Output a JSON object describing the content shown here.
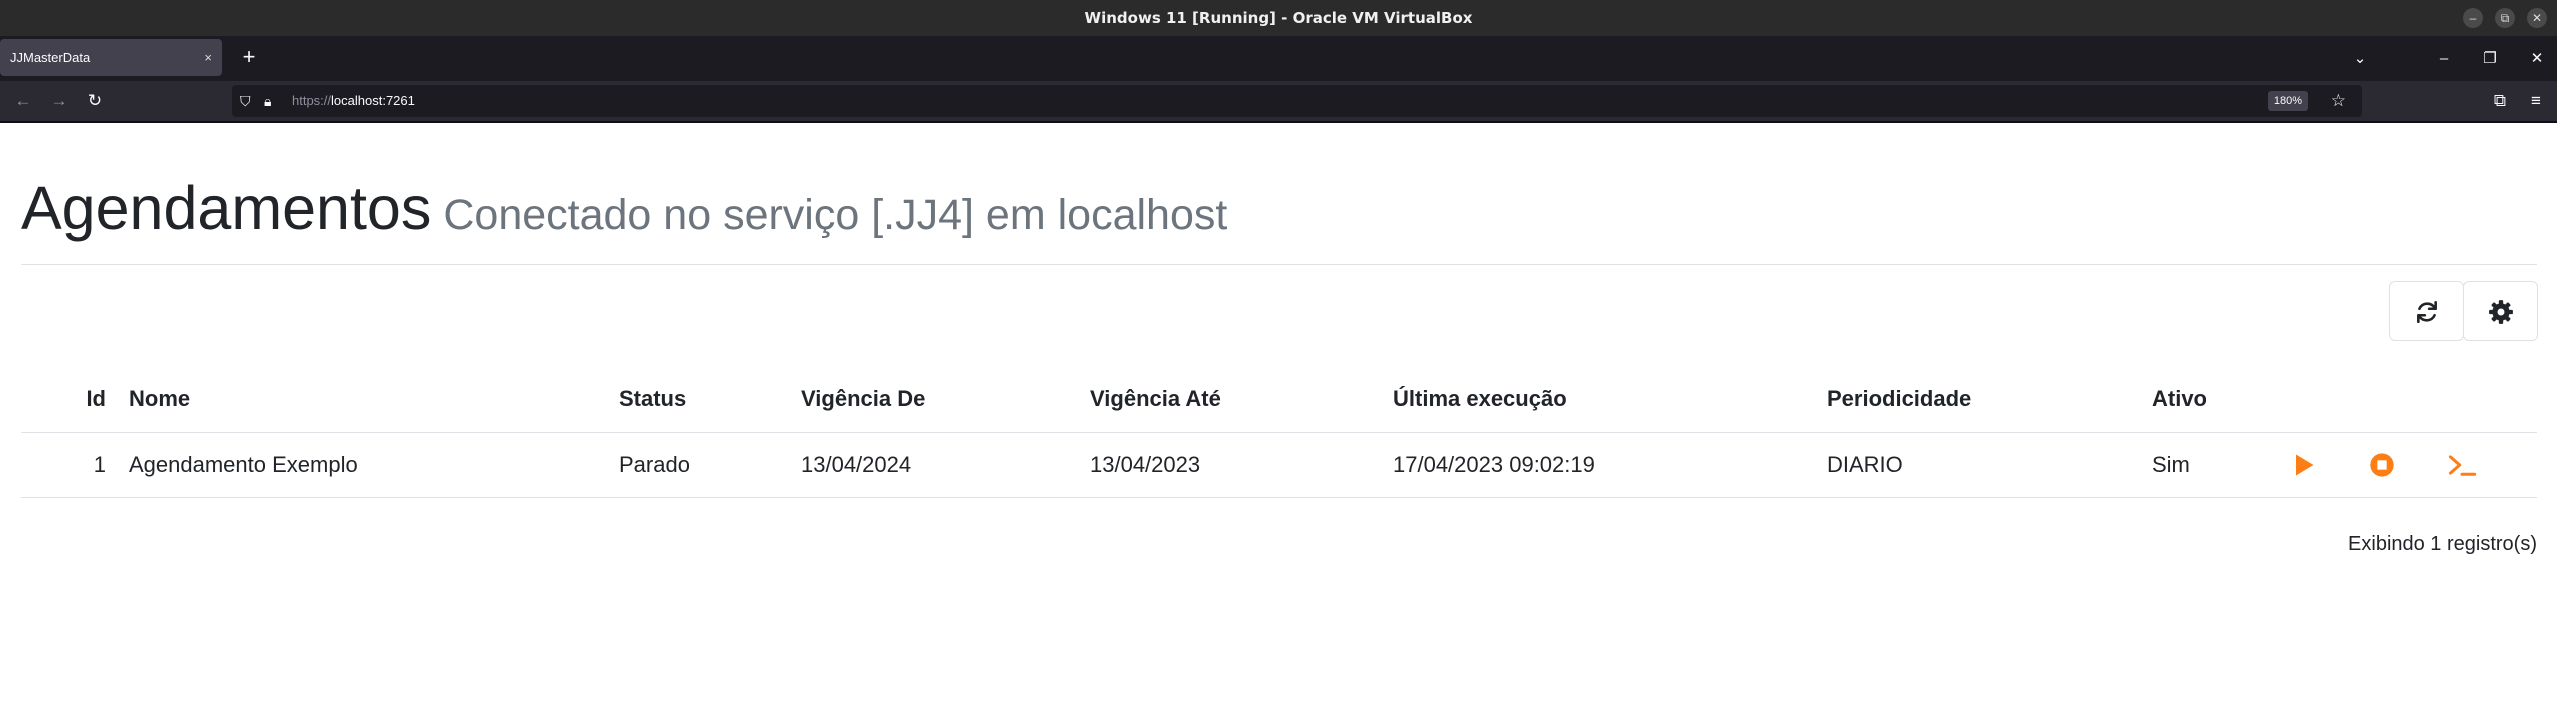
{
  "window": {
    "title": "Windows 11 [Running] - Oracle VM VirtualBox"
  },
  "browser": {
    "tab_title": "JJMasterData",
    "tab_close": "×",
    "new_tab": "+",
    "url_scheme": "https://",
    "url_host": "localhost:7261",
    "zoom": "180%"
  },
  "page": {
    "title": "Agendamentos",
    "subtitle": "Conectado no serviço [.JJ4] em localhost",
    "table": {
      "headers": {
        "id": "Id",
        "nome": "Nome",
        "status": "Status",
        "vigencia_de": "Vigência De",
        "vigencia_ate": "Vigência Até",
        "ultima_execucao": "Última execução",
        "periodicidade": "Periodicidade",
        "ativo": "Ativo"
      },
      "rows": [
        {
          "id": "1",
          "nome": "Agendamento Exemplo",
          "status": "Parado",
          "vigencia_de": "13/04/2024",
          "vigencia_ate": "13/04/2023",
          "ultima_execucao": "17/04/2023 09:02:19",
          "periodicidade": "DIARIO",
          "ativo": "Sim"
        }
      ]
    },
    "footer": "Exibindo 1 registro(s)",
    "icons": {
      "refresh": "refresh-icon",
      "settings": "gear-icon",
      "play": "play-icon",
      "stop": "stop-icon",
      "terminal": "terminal-icon"
    },
    "colors": {
      "accent": "#fd7e14",
      "text": "#212529",
      "muted": "#6c757d"
    }
  }
}
